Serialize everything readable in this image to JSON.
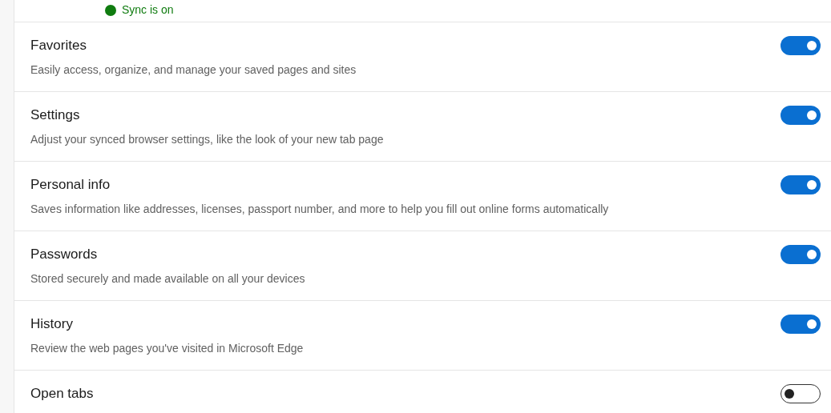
{
  "sync_status": {
    "text": "Sync is on",
    "on": true
  },
  "items": [
    {
      "title": "Favorites",
      "description": "Easily access, organize, and manage your saved pages and sites",
      "on": true
    },
    {
      "title": "Settings",
      "description": "Adjust your synced browser settings, like the look of your new tab page",
      "on": true
    },
    {
      "title": "Personal info",
      "description": "Saves information like addresses, licenses, passport number, and more to help you fill out online forms automatically",
      "on": true
    },
    {
      "title": "Passwords",
      "description": "Stored securely and made available on all your devices",
      "on": true
    },
    {
      "title": "History",
      "description": "Review the web pages you've visited in Microsoft Edge",
      "on": true
    },
    {
      "title": "Open tabs",
      "on": false
    }
  ]
}
